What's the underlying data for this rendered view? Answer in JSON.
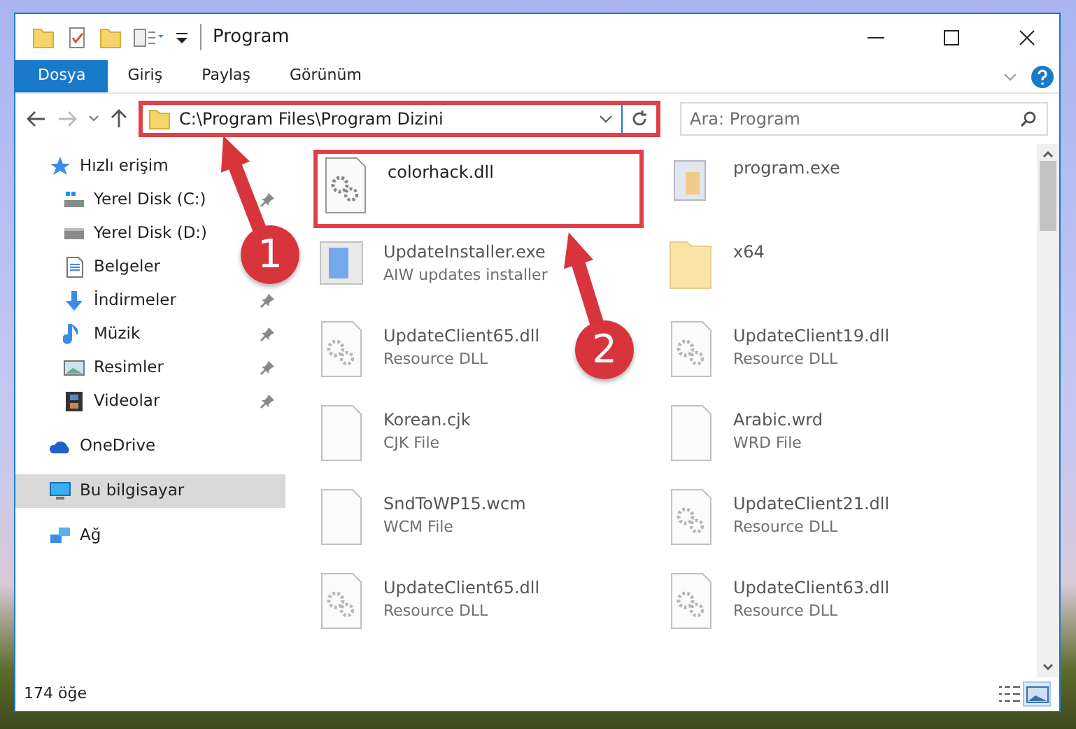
{
  "window": {
    "title": "Program"
  },
  "ribbon_tabs": [
    {
      "label": "Dosya",
      "selected": true
    },
    {
      "label": "Giriş",
      "selected": false
    },
    {
      "label": "Paylaş",
      "selected": false
    },
    {
      "label": "Görünüm",
      "selected": false
    }
  ],
  "address_bar": {
    "path": "C:\\Program Files\\Program Dizini",
    "highlighted": true
  },
  "search": {
    "placeholder": "Ara: Program"
  },
  "navigation": [
    {
      "label": "Hızlı erişim",
      "kind": "star",
      "selected": false,
      "children": [
        {
          "label": "Yerel Disk (C:)",
          "kind": "systemdrive",
          "pinned": true
        },
        {
          "label": "Yerel Disk (D:)",
          "kind": "drive",
          "pinned": false
        },
        {
          "label": "Belgeler",
          "kind": "document",
          "pinned": false
        },
        {
          "label": "İndirmeler",
          "kind": "download",
          "pinned": true
        },
        {
          "label": "Müzik",
          "kind": "music",
          "pinned": true
        },
        {
          "label": "Resimler",
          "kind": "picture",
          "pinned": true
        },
        {
          "label": "Videolar",
          "kind": "video",
          "pinned": true
        }
      ]
    },
    {
      "label": "OneDrive",
      "kind": "cloud",
      "selected": false
    },
    {
      "label": "Bu bilgisayar",
      "kind": "computer",
      "selected": true
    },
    {
      "label": "Ağ",
      "kind": "network",
      "selected": false
    }
  ],
  "files": [
    {
      "name": "colorhack.dll",
      "kind": "dll",
      "highlighted": true,
      "dimmed": false
    },
    {
      "name": "program.exe",
      "kind": "exe",
      "highlighted": false,
      "dimmed": true
    },
    {
      "name": "UpdateInstaller.exe",
      "type": "AIW updates installer",
      "kind": "installer",
      "highlighted": false,
      "dimmed": true
    },
    {
      "name": "x64",
      "kind": "folder",
      "highlighted": false,
      "dimmed": true
    },
    {
      "name": "UpdateClient65.dll",
      "type": "Resource DLL",
      "kind": "dll",
      "highlighted": false,
      "dimmed": true
    },
    {
      "name": "UpdateClient19.dll",
      "type": "Resource DLL",
      "kind": "dll",
      "highlighted": false,
      "dimmed": true
    },
    {
      "name": "Korean.cjk",
      "type": "CJK File",
      "kind": "file",
      "highlighted": false,
      "dimmed": true
    },
    {
      "name": "Arabic.wrd",
      "type": "WRD File",
      "kind": "file",
      "highlighted": false,
      "dimmed": true
    },
    {
      "name": "SndToWP15.wcm",
      "type": "WCM File",
      "kind": "file",
      "highlighted": false,
      "dimmed": true
    },
    {
      "name": "UpdateClient21.dll",
      "type": "Resource DLL",
      "kind": "dll",
      "highlighted": false,
      "dimmed": true
    },
    {
      "name": "UpdateClient65.dll",
      "type": "Resource DLL",
      "kind": "dll",
      "highlighted": false,
      "dimmed": true
    },
    {
      "name": "UpdateClient63.dll",
      "type": "Resource DLL",
      "kind": "dll",
      "highlighted": false,
      "dimmed": true
    }
  ],
  "status_bar": {
    "count": "174 öğe"
  },
  "view_buttons": [
    {
      "kind": "details",
      "selected": false
    },
    {
      "kind": "large-icons",
      "selected": true
    }
  ],
  "annotations": [
    {
      "label": "1"
    },
    {
      "label": "2"
    }
  ]
}
